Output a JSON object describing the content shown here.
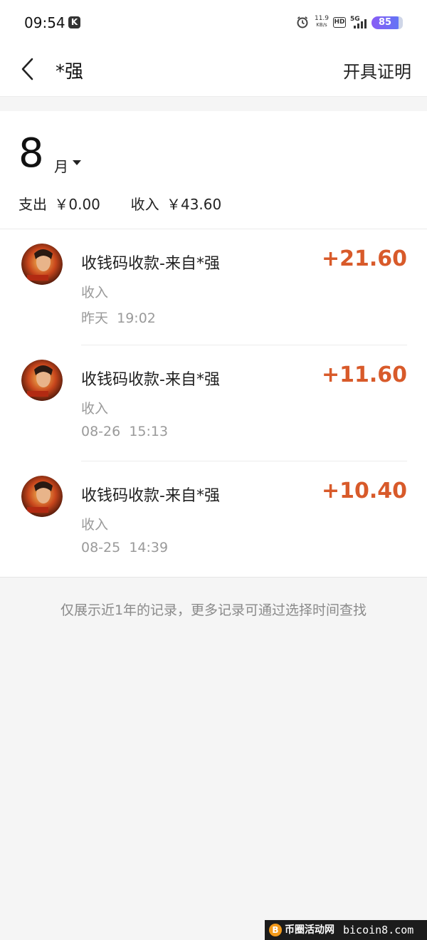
{
  "status_bar": {
    "time": "09:54",
    "k_badge": "K",
    "net_speed_value": "11.9",
    "net_speed_unit": "KB/s",
    "hd": "HD",
    "network": "5G",
    "battery": "85"
  },
  "nav": {
    "title": "*强",
    "action": "开具证明"
  },
  "summary": {
    "month": "8",
    "month_unit": "月",
    "expense_label": "支出",
    "expense_value": "￥0.00",
    "income_label": "收入",
    "income_value": "￥43.60"
  },
  "transactions": [
    {
      "title": "收钱码收款-来自*强",
      "type": "收入",
      "date": "昨天",
      "time": "19:02",
      "amount": "+21.60"
    },
    {
      "title": "收钱码收款-来自*强",
      "type": "收入",
      "date": "08-26",
      "time": "15:13",
      "amount": "+11.60"
    },
    {
      "title": "收钱码收款-来自*强",
      "type": "收入",
      "date": "08-25",
      "time": "14:39",
      "amount": "+10.40"
    }
  ],
  "footer_note": "仅展示近1年的记录，更多记录可通过选择时间查找",
  "watermark": {
    "coin": "B",
    "site_cn": "币圈活动网",
    "site_en": "bicoin8.com"
  },
  "colors": {
    "amount": "#d85a2a",
    "battery_start": "#8a5cf5",
    "battery_end": "#5c78f5"
  }
}
